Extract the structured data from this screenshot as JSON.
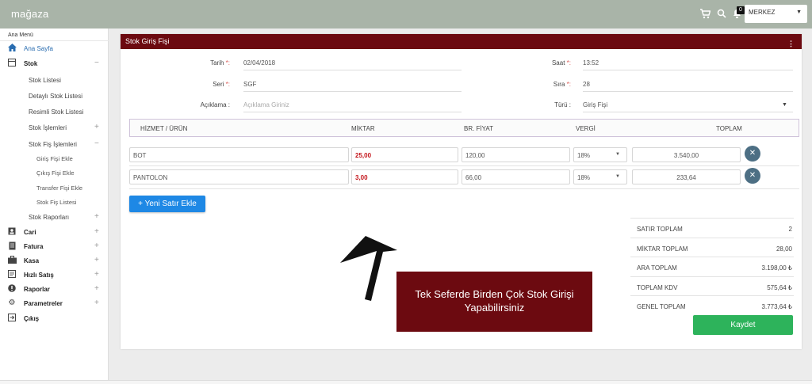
{
  "app": {
    "brand": "mağaza",
    "notification_count": "0",
    "branch": "MERKEZ"
  },
  "sidebar": {
    "heading": "Ana Menü",
    "items": [
      {
        "label": "Ana Sayfa",
        "icon": "home-icon",
        "toggle": ""
      },
      {
        "label": "Stok",
        "icon": "stock-icon",
        "toggle": "−"
      },
      {
        "label": "Stok Listesi"
      },
      {
        "label": "Detaylı Stok Listesi"
      },
      {
        "label": "Resimli Stok Listesi"
      },
      {
        "label": "Stok İşlemleri",
        "toggle": "+"
      },
      {
        "label": "Stok Fiş İşlemleri",
        "toggle": "−"
      },
      {
        "label": "Giriş Fişi Ekle"
      },
      {
        "label": "Çıkış Fişi Ekle"
      },
      {
        "label": "Transfer Fişi Ekle"
      },
      {
        "label": "Stok Fiş Listesi"
      },
      {
        "label": "Stok Raporları",
        "toggle": "+"
      },
      {
        "label": "Cari",
        "icon": "contact-icon",
        "toggle": "+"
      },
      {
        "label": "Fatura",
        "icon": "invoice-icon",
        "toggle": "+"
      },
      {
        "label": "Kasa",
        "icon": "briefcase-icon",
        "toggle": "+"
      },
      {
        "label": "Hızlı Satış",
        "icon": "quick-sale-icon",
        "toggle": "+"
      },
      {
        "label": "Raporlar",
        "icon": "report-icon",
        "toggle": "+"
      },
      {
        "label": "Parametreler",
        "icon": "gear-icon",
        "toggle": "+"
      },
      {
        "label": "Çıkış",
        "icon": "logout-icon",
        "toggle": ""
      }
    ]
  },
  "form": {
    "title": "Stok Giriş Fişi",
    "date_label": "Tarih",
    "date_value": "02/04/2018",
    "time_label": "Saat",
    "time_value": "13:52",
    "series_label": "Seri",
    "series_value": "SGF",
    "seq_label": "Sıra",
    "seq_value": "28",
    "desc_label": "Açıklama :",
    "desc_placeholder": "Açıklama Giriniz",
    "type_label": "Türü :",
    "type_value": "Giriş Fişi"
  },
  "table": {
    "headers": [
      "HİZMET / ÜRÜN",
      "MİKTAR",
      "BR. FİYAT",
      "VERGİ",
      "TOPLAM"
    ],
    "rows": [
      {
        "product": "BOT",
        "qty": "25,00",
        "price": "120,00",
        "tax": "18%",
        "total": "3.540,00"
      },
      {
        "product": "PANTOLON",
        "qty": "3,00",
        "price": "66,00",
        "tax": "18%",
        "total": "233,64"
      }
    ]
  },
  "add_row_label": "+ Yeni Satır Ekle",
  "totals": [
    {
      "label": "SATIR TOPLAM",
      "value": "2"
    },
    {
      "label": "MİKTAR TOPLAM",
      "value": "28,00"
    },
    {
      "label": "ARA TOPLAM",
      "value": "3.198,00 ₺"
    },
    {
      "label": "TOPLAM KDV",
      "value": "575,64 ₺"
    },
    {
      "label": "GENEL TOPLAM",
      "value": "3.773,64 ₺"
    }
  ],
  "save_label": "Kaydet",
  "tooltip": {
    "line1": "Tek Seferde Birden Çok Stok Girişi",
    "line2": "Yapabilirsiniz"
  },
  "colors": {
    "header": "#a9b4a8",
    "card_header": "#6c0a10",
    "primary": "#1e88e5",
    "success": "#2db35b"
  }
}
